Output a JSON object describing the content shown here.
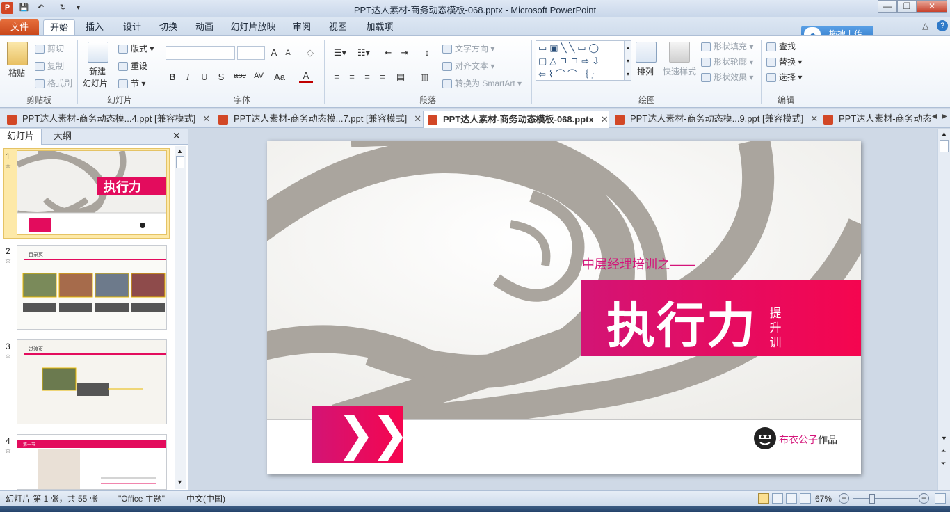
{
  "window": {
    "title": "PPT达人素材-商务动态模板-068.pptx - Microsoft PowerPoint"
  },
  "quick_access": {
    "app_icon": "P",
    "save": "💾",
    "undo": "↶",
    "redo": "↻",
    "more": "▾"
  },
  "window_controls": {
    "minimize": "—",
    "restore": "❐",
    "close": "✕"
  },
  "ribbon_tabs": [
    "文件",
    "开始",
    "插入",
    "设计",
    "切换",
    "动画",
    "幻灯片放映",
    "审阅",
    "视图",
    "加载项"
  ],
  "upload_button": {
    "label": "拖拽上传"
  },
  "help": {
    "collapse": "△",
    "help": "?"
  },
  "ribbon": {
    "clipboard": {
      "paste": "粘贴",
      "cut": "剪切",
      "copy": "复制",
      "format_painter": "格式刷",
      "label": "剪贴板"
    },
    "slides": {
      "new_slide": "新建",
      "new_slide2": "幻灯片",
      "layout": "版式",
      "reset": "重设",
      "section": "节",
      "label": "幻灯片"
    },
    "font": {
      "bold": "B",
      "italic": "I",
      "underline": "U",
      "shadow": "S",
      "strike": "abc",
      "spacing": "AV",
      "case": "Aa",
      "color": "A",
      "grow": "A",
      "shrink": "A",
      "label": "字体"
    },
    "paragraph": {
      "text_direction": "文字方向",
      "align_text": "对齐文本",
      "smartart": "转换为 SmartArt",
      "label": "段落"
    },
    "drawing": {
      "arrange": "排列",
      "quick_styles": "快速样式",
      "fill": "形状填充",
      "outline": "形状轮廓",
      "effects": "形状效果",
      "label": "绘图"
    },
    "editing": {
      "find": "查找",
      "replace": "替换",
      "select": "选择",
      "label": "编辑"
    }
  },
  "doc_tabs": [
    {
      "label": "PPT达人素材-商务动态模...4.ppt [兼容模式]",
      "active": false
    },
    {
      "label": "PPT达人素材-商务动态模...7.ppt [兼容模式]",
      "active": false
    },
    {
      "label": "PPT达人素材-商务动态模板-068.pptx",
      "active": true
    },
    {
      "label": "PPT达人素材-商务动态模...9.ppt [兼容模式]",
      "active": false
    },
    {
      "label": "PPT达人素材-商务动态模",
      "active": false
    }
  ],
  "left_pane": {
    "tab_slides": "幻灯片",
    "tab_outline": "大纲",
    "close": "✕"
  },
  "thumbnails": [
    {
      "num": "1",
      "star": "☆",
      "title": "执行力"
    },
    {
      "num": "2",
      "star": "☆",
      "title": "目录页"
    },
    {
      "num": "3",
      "star": "☆",
      "title": "过渡页"
    },
    {
      "num": "4",
      "star": "☆",
      "title": "第一节"
    }
  ],
  "slide": {
    "subtitle": "中层经理培训之——",
    "title": "执行力",
    "vertical_text": "提升训",
    "chevrons": "❯❯",
    "brand_pink": "布衣公子",
    "brand_gray": "作品"
  },
  "status": {
    "slide_info": "幻灯片 第 1 张，共 55 张",
    "theme": "\"Office 主题\"",
    "language": "中文(中国)",
    "zoom": "67%",
    "zoom_out": "−",
    "zoom_in": "+"
  },
  "colors": {
    "accent_pink": "#d4147a",
    "accent_red": "#f5054f",
    "file_tab": "#d24726"
  }
}
